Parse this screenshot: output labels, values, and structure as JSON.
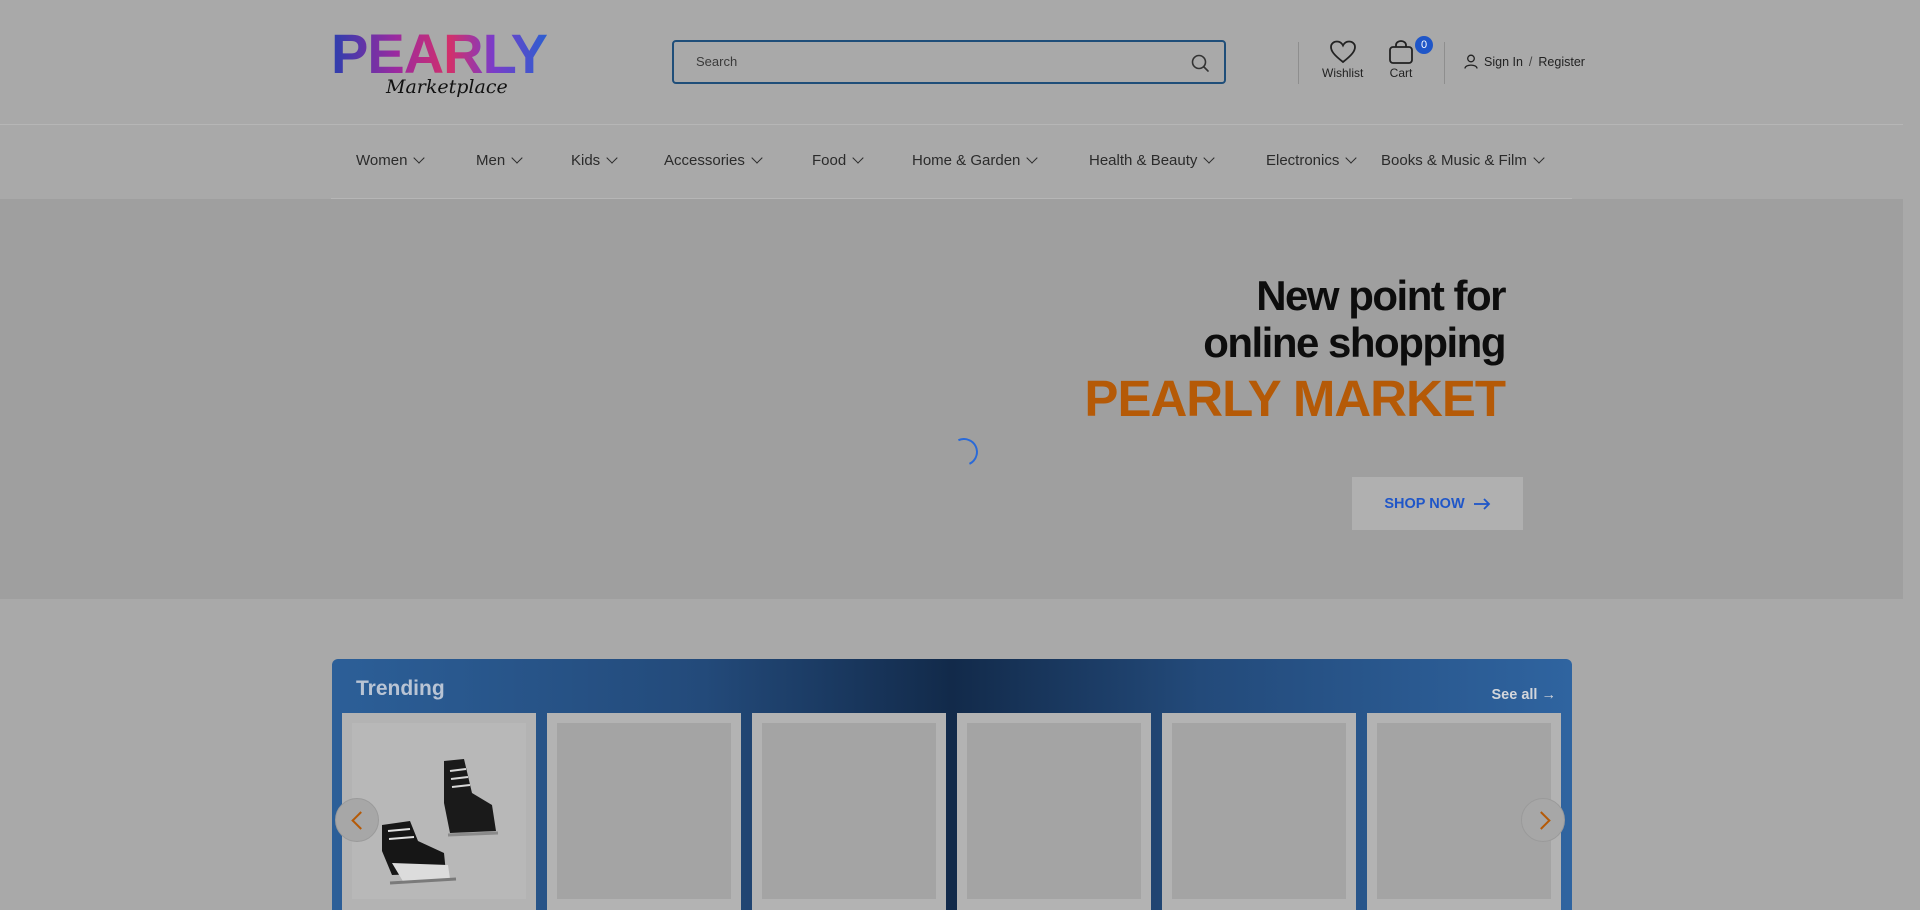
{
  "header": {
    "logo_text": "PEARLY",
    "logo_subtext": "Marketplace",
    "search_placeholder": "Search",
    "wishlist_label": "Wishlist",
    "cart_label": "Cart",
    "cart_count": "0",
    "sign_in": "Sign In",
    "separator": "/",
    "register": "Register"
  },
  "nav": {
    "items": [
      {
        "label": "Women"
      },
      {
        "label": "Men"
      },
      {
        "label": "Kids"
      },
      {
        "label": "Accessories"
      },
      {
        "label": "Food"
      },
      {
        "label": "Home & Garden"
      },
      {
        "label": "Health & Beauty"
      },
      {
        "label": "Electronics"
      },
      {
        "label": "Books & Music & Film"
      }
    ]
  },
  "hero": {
    "line1": "New point for",
    "line2": "online shopping",
    "brand": "PEARLY MARKET",
    "cta": "SHOP NOW"
  },
  "trending": {
    "title": "Trending",
    "see_all": "See all →",
    "products": [
      {
        "image": "ice-skates"
      },
      {
        "image": "placeholder"
      },
      {
        "image": "placeholder"
      },
      {
        "image": "placeholder"
      },
      {
        "image": "placeholder"
      },
      {
        "image": "placeholder"
      }
    ]
  },
  "colors": {
    "accent_blue": "#1f56c8",
    "brand_orange": "#b55a07",
    "overlay_gray": "#a9a9a9"
  },
  "icons": [
    "search-icon",
    "heart-icon",
    "cart-icon",
    "user-icon",
    "arrow-right-icon",
    "chevron-down-icon",
    "loading-spinner",
    "chevron-left-icon",
    "chevron-right-icon"
  ]
}
